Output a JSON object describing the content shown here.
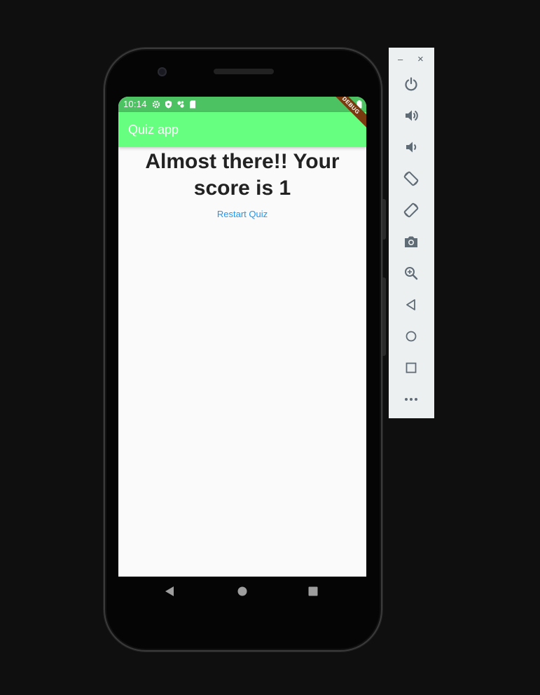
{
  "status_bar": {
    "time": "10:14",
    "icons": [
      "settings-icon",
      "shield-icon",
      "fan-icon",
      "sd-card-icon"
    ],
    "battery_icon": "battery-icon",
    "color": "#4cc262"
  },
  "app_bar": {
    "title": "Quiz app",
    "color": "#66ff7f"
  },
  "debug_banner": "DEBUG",
  "result": {
    "text": "Almost there!! Your score is 1"
  },
  "restart_button": {
    "label": "Restart Quiz",
    "color": "#2196f3"
  },
  "nav_bar": {
    "buttons": [
      "back-triangle-icon",
      "home-circle-icon",
      "recents-square-icon"
    ]
  },
  "emulator_toolbar": {
    "window_controls": [
      "minimize",
      "close"
    ],
    "window_glyphs": {
      "minimize": "–",
      "close": "×"
    },
    "buttons": [
      "power-icon",
      "volume-up-icon",
      "volume-down-icon",
      "rotate-left-icon",
      "rotate-right-icon",
      "camera-icon",
      "zoom-icon",
      "back-icon",
      "home-icon",
      "overview-icon",
      "more-icon"
    ]
  }
}
